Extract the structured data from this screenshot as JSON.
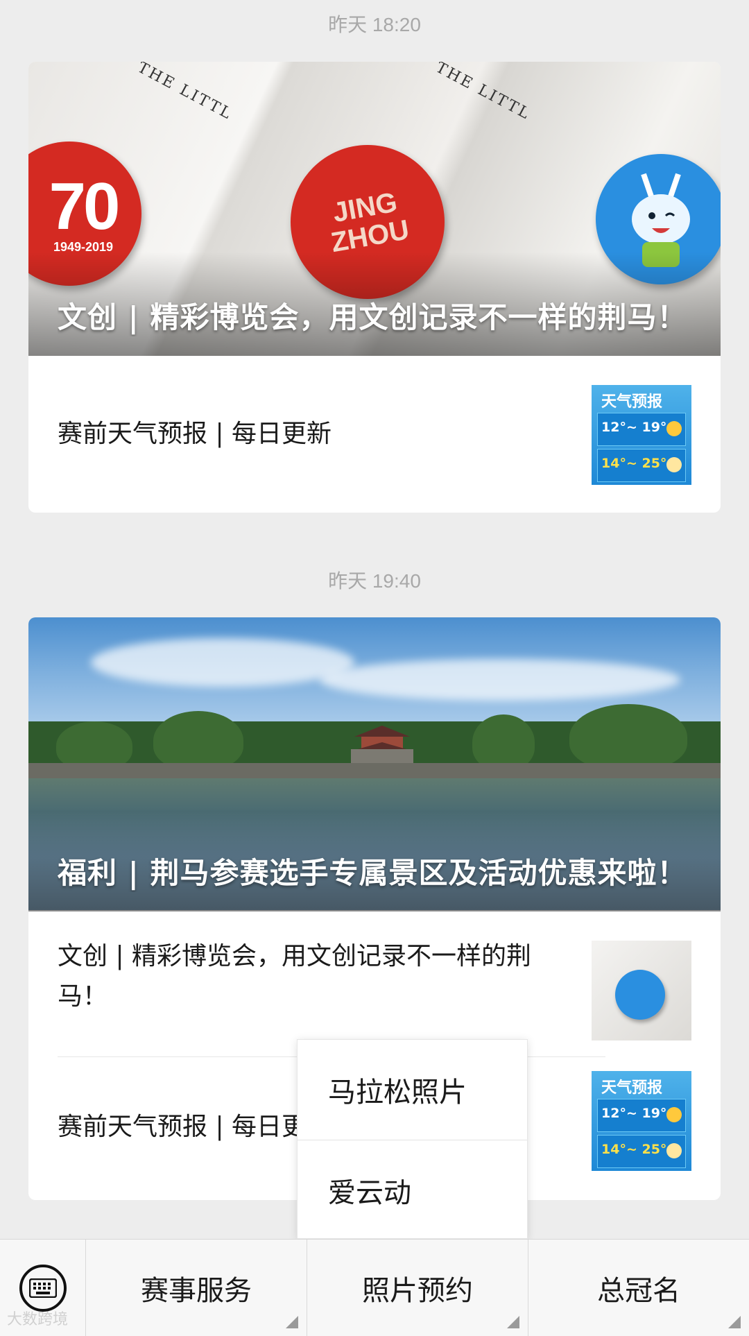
{
  "feed": [
    {
      "timestamp": "昨天 18:20",
      "cover_title": "文创 | 精彩博览会，用文创记录不一样的荆马！",
      "cover_badges": [
        "70",
        "1949-2019",
        "JING ZHOU"
      ],
      "items": [
        {
          "title": "赛前天气预报 | 每日更新",
          "thumb": "weather-forecast"
        }
      ]
    },
    {
      "timestamp": "昨天 19:40",
      "cover_title": "福利 | 荆马参赛选手专属景区及活动优惠来啦！",
      "items": [
        {
          "title": "文创 | 精彩博览会，用文创记录不一样的荆马！",
          "thumb": "mascot-badge"
        },
        {
          "title": "赛前天气预报 | 每日更新",
          "thumb": "weather-forecast"
        }
      ]
    }
  ],
  "weather_thumb": {
    "title": "天气预报",
    "temp1": "12°~ 19°",
    "temp2": "14°~ 25°"
  },
  "popup": {
    "items": [
      "马拉松照片",
      "爱云动"
    ]
  },
  "menubar": {
    "keyboard_icon": "keyboard-icon",
    "buttons": [
      "赛事服务",
      "照片预约",
      "总冠名"
    ]
  },
  "watermark": "大数跨境",
  "colors": {
    "background": "#ededed",
    "badge_red": "#d42a22",
    "badge_blue": "#2a8fe0",
    "timestamp": "#a8a8a8"
  }
}
